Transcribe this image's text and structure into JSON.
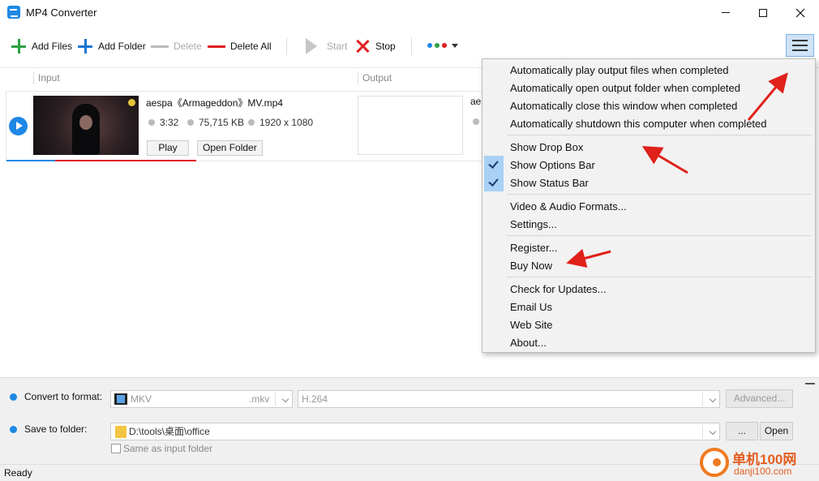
{
  "window": {
    "title": "MP4 Converter"
  },
  "toolbar": {
    "add_files": "Add Files",
    "add_folder": "Add Folder",
    "delete": "Delete",
    "delete_all": "Delete All",
    "start": "Start",
    "stop": "Stop",
    "dot_colors": [
      "#1e88e5",
      "#2ea043",
      "#e02020"
    ]
  },
  "list": {
    "headers": {
      "input": "Input",
      "output": "Output"
    },
    "item": {
      "filename": "aespa《Armageddon》MV.mp4",
      "duration": "3:32",
      "size": "75,715 KB",
      "resolution": "1920 x 1080",
      "play_label": "Play",
      "open_folder_label": "Open Folder",
      "output_name_partial": "aes"
    }
  },
  "menu": {
    "group1": [
      "Automatically play output files when completed",
      "Automatically open output folder when completed",
      "Automatically close this window when completed",
      "Automatically shutdown this computer when completed"
    ],
    "show_drop_box": "Show Drop Box",
    "show_options_bar": "Show Options Bar",
    "show_status_bar": "Show Status Bar",
    "video_audio_formats": "Video & Audio Formats...",
    "settings": "Settings...",
    "register": "Register...",
    "buy_now": "Buy Now",
    "check_updates": "Check for Updates...",
    "email_us": "Email Us",
    "web_site": "Web Site",
    "about": "About..."
  },
  "options": {
    "convert_label": "Convert to format:",
    "format_name": "MKV",
    "format_ext": ".mkv",
    "codec": "H.264",
    "advanced_label": "Advanced...",
    "save_label": "Save to folder:",
    "folder_path": "D:\\tools\\桌面\\office",
    "browse_label": "...",
    "open_label": "Open",
    "same_as_input": "Same as input folder"
  },
  "status": {
    "text": "Ready"
  },
  "watermark": {
    "line1": "单机100网",
    "line2": "danji100.com"
  }
}
